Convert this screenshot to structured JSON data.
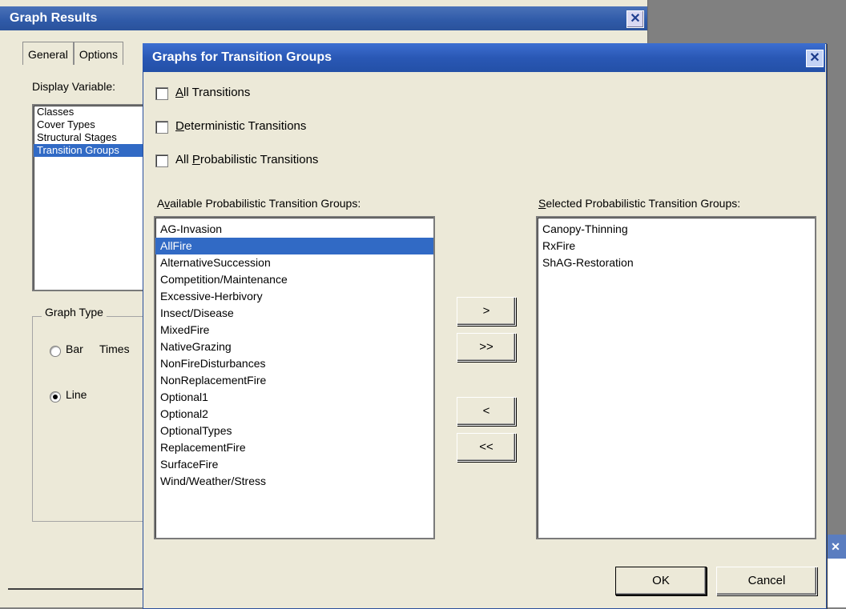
{
  "background_window": {
    "title": "Graph Results",
    "close_glyph": "✕",
    "tabs": [
      "General",
      "Options"
    ],
    "display_variable_label": "Display Variable:",
    "display_variable_items": [
      {
        "label": "Classes",
        "selected": false
      },
      {
        "label": "Cover Types",
        "selected": false
      },
      {
        "label": "Structural Stages",
        "selected": false
      },
      {
        "label": "Transition Groups",
        "selected": true
      }
    ],
    "graph_type_label": "Graph Type",
    "graph_type_options": [
      {
        "label": "Bar",
        "checked": false
      },
      {
        "label": "Line",
        "checked": true
      }
    ],
    "times_label": "Times"
  },
  "dialog": {
    "title": "Graphs for Transition Groups",
    "close_glyph": "✕",
    "checkboxes": [
      {
        "pre": "",
        "accel": "A",
        "post": "ll Transitions",
        "checked": false
      },
      {
        "pre": "",
        "accel": "D",
        "post": "eterministic Transitions",
        "checked": false
      },
      {
        "pre": "All ",
        "accel": "P",
        "post": "robabilistic Transitions",
        "checked": false
      }
    ],
    "available_label": {
      "pre": "A",
      "accel": "v",
      "post": "ailable Probabilistic Transition Groups:"
    },
    "available_items": [
      {
        "label": "AG-Invasion",
        "selected": false
      },
      {
        "label": "AllFire",
        "selected": true
      },
      {
        "label": "AlternativeSuccession",
        "selected": false
      },
      {
        "label": "Competition/Maintenance",
        "selected": false
      },
      {
        "label": "Excessive-Herbivory",
        "selected": false
      },
      {
        "label": "Insect/Disease",
        "selected": false
      },
      {
        "label": "MixedFire",
        "selected": false
      },
      {
        "label": "NativeGrazing",
        "selected": false
      },
      {
        "label": "NonFireDisturbances",
        "selected": false
      },
      {
        "label": "NonReplacementFire",
        "selected": false
      },
      {
        "label": "Optional1",
        "selected": false
      },
      {
        "label": "Optional2",
        "selected": false
      },
      {
        "label": "OptionalTypes",
        "selected": false
      },
      {
        "label": "ReplacementFire",
        "selected": false
      },
      {
        "label": "SurfaceFire",
        "selected": false
      },
      {
        "label": "Wind/Weather/Stress",
        "selected": false
      }
    ],
    "selected_label": {
      "pre": "",
      "accel": "S",
      "post": "elected Probabilistic Transition Groups:"
    },
    "selected_items": [
      {
        "label": "Canopy-Thinning"
      },
      {
        "label": "RxFire"
      },
      {
        "label": "ShAG-Restoration"
      }
    ],
    "move_buttons": {
      "add_one": ">",
      "add_all": ">>",
      "remove_one": "<",
      "remove_all": "<<"
    },
    "ok_label": "OK",
    "cancel_label": "Cancel"
  }
}
